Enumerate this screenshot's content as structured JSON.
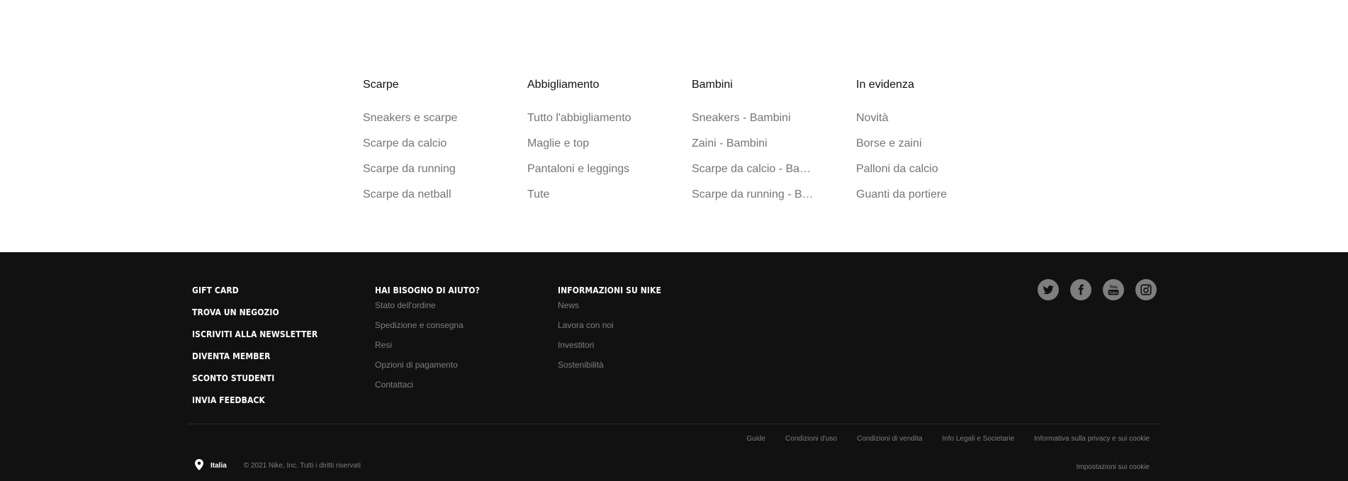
{
  "menu": {
    "columns": [
      {
        "title": "Scarpe",
        "items": [
          "Sneakers e scarpe",
          "Scarpe da calcio",
          "Scarpe da running",
          "Scarpe da netball"
        ]
      },
      {
        "title": "Abbigliamento",
        "items": [
          "Tutto l'abbigliamento",
          "Maglie e top",
          "Pantaloni e leggings",
          "Tute"
        ]
      },
      {
        "title": "Bambini",
        "items": [
          "Sneakers - Bambini",
          "Zaini - Bambini",
          "Scarpe da calcio - Bam…",
          "Scarpe da running - Ba…"
        ]
      },
      {
        "title": "In evidenza",
        "items": [
          "Novità",
          "Borse e zaini",
          "Palloni da calcio",
          "Guanti da portiere"
        ]
      }
    ]
  },
  "footer": {
    "primary_links": [
      "GIFT CARD",
      "TROVA UN NEGOZIO",
      "ISCRIVITI ALLA NEWSLETTER",
      "DIVENTA MEMBER",
      "SCONTO STUDENTI",
      "INVIA FEEDBACK"
    ],
    "help": {
      "title": "HAI BISOGNO DI AIUTO?",
      "items": [
        "Stato dell'ordine",
        "Spedizione e consegna",
        "Resi",
        "Opzioni di pagamento",
        "Contattaci"
      ]
    },
    "about": {
      "title": "INFORMAZIONI SU NIKE",
      "items": [
        "News",
        "Lavora con noi",
        "Investitori",
        "Sostenibilità"
      ]
    },
    "social": [
      {
        "name": "twitter-icon"
      },
      {
        "name": "facebook-icon"
      },
      {
        "name": "youtube-icon",
        "text": "You Tube"
      },
      {
        "name": "instagram-icon"
      }
    ],
    "legal_links": [
      "Guide",
      "Condizioni d'uso",
      "Condizioni di vendita",
      "Info Legali e Societarie",
      "Informativa sulla privacy e sui cookie"
    ],
    "country": "Italia",
    "copyright": "© 2021 Nike, Inc. Tutti i diritti riservati",
    "cookie_settings": "Impostazioni sui cookie"
  }
}
